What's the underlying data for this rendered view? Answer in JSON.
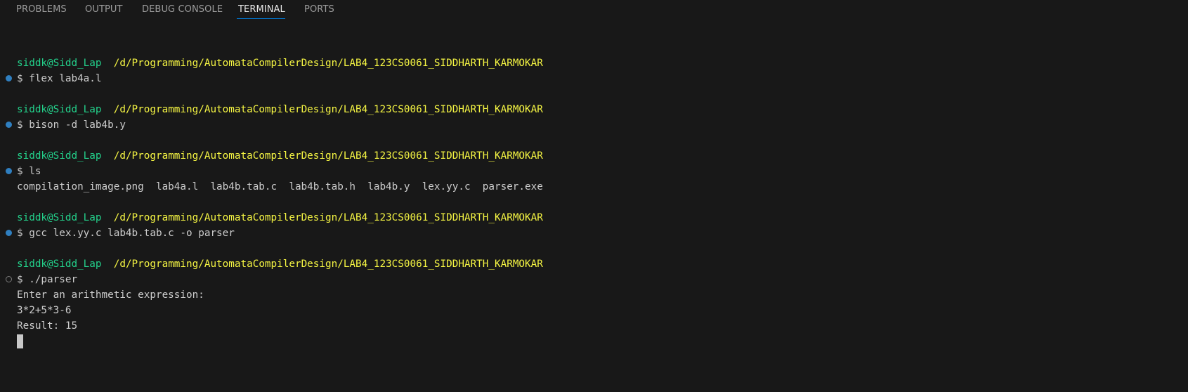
{
  "panel": {
    "tabs": [
      {
        "label": "PROBLEMS"
      },
      {
        "label": "OUTPUT"
      },
      {
        "label": "DEBUG CONSOLE"
      },
      {
        "label": "TERMINAL"
      },
      {
        "label": "PORTS"
      }
    ],
    "active_tab": "TERMINAL"
  },
  "terminal": {
    "prompt_user": "siddk@Sidd_Lap",
    "prompt_path": "/d/Programming/AutomataCompilerDesign/LAB4_123CS0061_SIDDHARTH_KARMOKAR",
    "commands": [
      {
        "command": "$ flex lab4a.l",
        "status": "success"
      },
      {
        "command": "$ bison -d lab4b.y",
        "status": "success"
      },
      {
        "command": "$ ls",
        "status": "success",
        "output": "compilation_image.png  lab4a.l  lab4b.tab.c  lab4b.tab.h  lab4b.y  lex.yy.c  parser.exe"
      },
      {
        "command": "$ gcc lex.yy.c lab4b.tab.c -o parser",
        "status": "success"
      },
      {
        "command": "$ ./parser",
        "status": "running",
        "output_lines": [
          "Enter an arithmetic expression:",
          "3*2+5*3-6",
          "Result: 15"
        ]
      }
    ]
  }
}
